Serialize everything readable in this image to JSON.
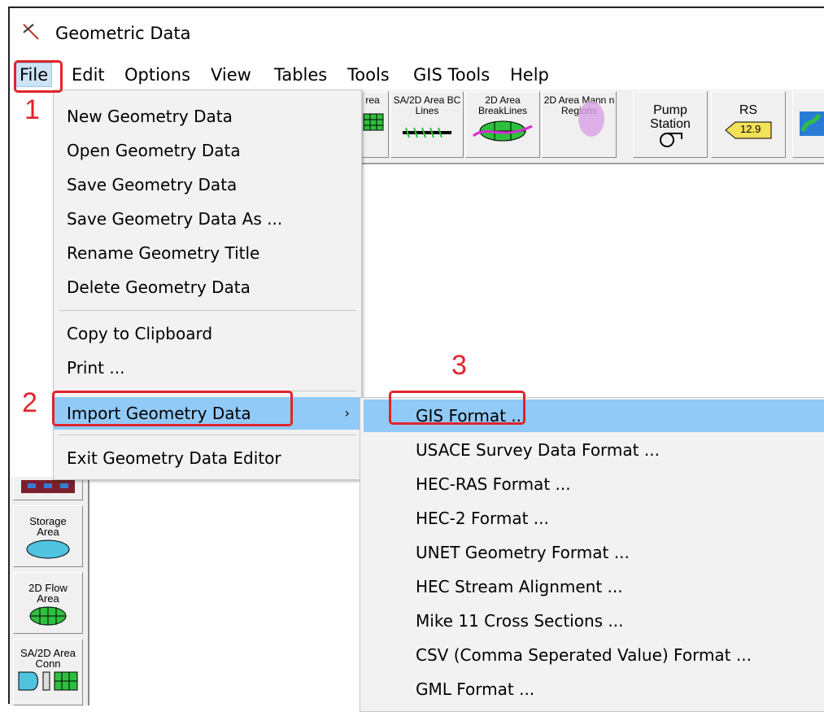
{
  "window": {
    "title": "Geometric Data"
  },
  "menubar": [
    "File",
    "Edit",
    "Options",
    "View",
    "Tables",
    "Tools",
    "GIS Tools",
    "Help"
  ],
  "toolbar": {
    "buttons": [
      {
        "label": "rea",
        "icon": "grid-icon"
      },
      {
        "label": "SA/2D Area BC Lines",
        "icon": "bc-lines-icon"
      },
      {
        "label": "2D Area BreakLines",
        "icon": "breaklines-icon"
      },
      {
        "label": "2D Area Mann n Regions",
        "icon": "mannings-regions-icon"
      },
      {
        "label": "Pump Station",
        "icon": "pump-icon"
      },
      {
        "label": "RS",
        "icon": "rs-tag-icon",
        "tag": "12.9"
      },
      {
        "label": "",
        "icon": "map-icon"
      }
    ]
  },
  "left_toolbar": [
    {
      "label": "",
      "icon": "junction-icon"
    },
    {
      "label": "Storage Area",
      "icon": "storage-area-icon"
    },
    {
      "label": "2D Flow Area",
      "icon": "2d-flow-area-icon"
    },
    {
      "label": "SA/2D Area Conn",
      "icon": "sa-2d-conn-icon"
    }
  ],
  "file_menu": {
    "items": [
      "New Geometry Data",
      "Open Geometry Data",
      "Save Geometry Data",
      "Save Geometry Data As ...",
      "Rename Geometry Title",
      "Delete Geometry Data",
      "Copy to Clipboard",
      "Print ...",
      "Import Geometry Data",
      "Exit Geometry Data Editor"
    ],
    "submenu_arrow": "›"
  },
  "import_submenu": [
    "GIS Format ...",
    "USACE Survey Data Format ...",
    "HEC-RAS Format ...",
    "HEC-2 Format ...",
    "UNET Geometry Format ...",
    "HEC Stream Alignment ...",
    "Mike 11 Cross Sections ...",
    "CSV (Comma Seperated Value) Format ...",
    "GML Format ..."
  ],
  "annotations": {
    "step1": "1",
    "step2": "2",
    "step3": "3",
    "color": "#e0242b"
  },
  "colors": {
    "highlight": "#91c9f7",
    "menu_bg": "#f2f2f2",
    "toolbar_bg": "#f0f0f0"
  }
}
